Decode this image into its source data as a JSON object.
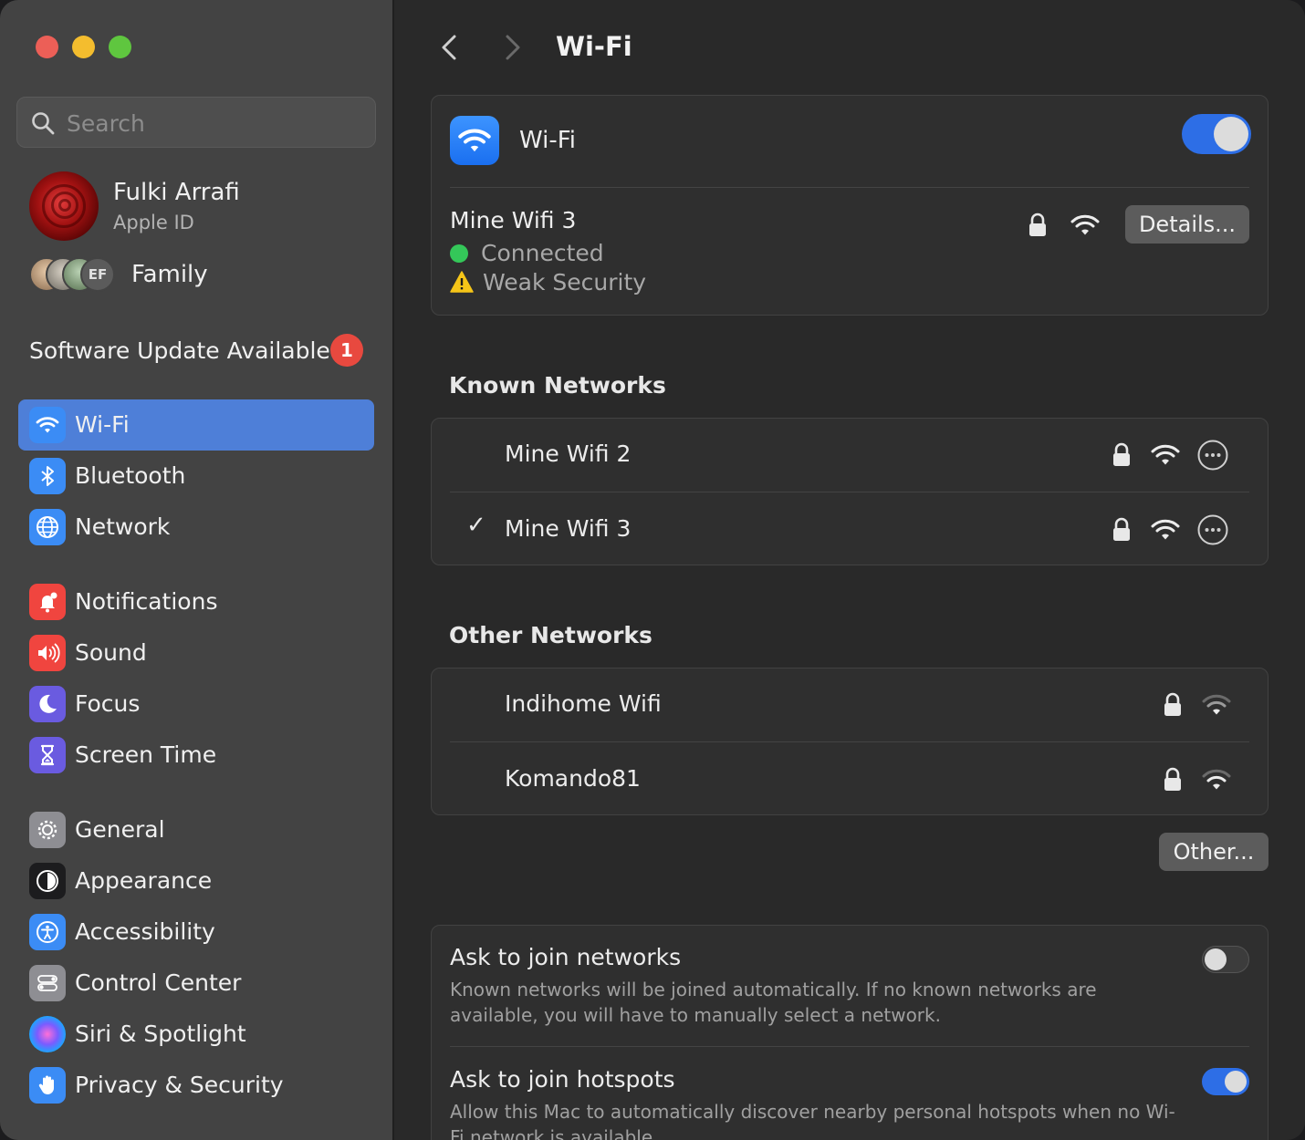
{
  "sidebar": {
    "search_placeholder": "Search",
    "profile": {
      "name": "Fulki Arrafi",
      "subtitle": "Apple ID"
    },
    "family": {
      "avatar_initials": "EF",
      "label": "Family"
    },
    "software_update": {
      "label": "Software Update Available",
      "badge": "1"
    },
    "items": [
      {
        "label": "Wi-Fi",
        "icon": "wifi-icon",
        "color": "#3b8cf5",
        "active": true
      },
      {
        "label": "Bluetooth",
        "icon": "bluetooth-icon",
        "color": "#3b8cf5"
      },
      {
        "label": "Network",
        "icon": "globe-icon",
        "color": "#3b8cf5"
      },
      {
        "label": "Notifications",
        "icon": "bell-icon",
        "color": "#f0453f"
      },
      {
        "label": "Sound",
        "icon": "speaker-icon",
        "color": "#f0453f"
      },
      {
        "label": "Focus",
        "icon": "moon-icon",
        "color": "#6a5be0"
      },
      {
        "label": "Screen Time",
        "icon": "hourglass-icon",
        "color": "#6a5be0"
      },
      {
        "label": "General",
        "icon": "gear-icon",
        "color": "#8e8e93"
      },
      {
        "label": "Appearance",
        "icon": "appearance-icon",
        "color": "#1c1c1e"
      },
      {
        "label": "Accessibility",
        "icon": "accessibility-icon",
        "color": "#3b8cf5"
      },
      {
        "label": "Control Center",
        "icon": "control-center-icon",
        "color": "#8e8e93"
      },
      {
        "label": "Siri & Spotlight",
        "icon": "siri-icon",
        "color": "#2b2b55"
      },
      {
        "label": "Privacy & Security",
        "icon": "hand-icon",
        "color": "#3b8cf5"
      }
    ]
  },
  "header": {
    "title": "Wi-Fi"
  },
  "wifi": {
    "label": "Wi-Fi",
    "enabled": true,
    "current": {
      "name": "Mine Wifi 3",
      "status": "Connected",
      "warning": "Weak Security",
      "details_label": "Details..."
    }
  },
  "known_networks": {
    "title": "Known Networks",
    "items": [
      {
        "name": "Mine Wifi 2",
        "checked": false
      },
      {
        "name": "Mine Wifi 3",
        "checked": true,
        "check_mark": "✓"
      }
    ]
  },
  "other_networks": {
    "title": "Other Networks",
    "items": [
      {
        "name": "Indihome Wifi"
      },
      {
        "name": "Komando81"
      }
    ],
    "other_label": "Other..."
  },
  "options": {
    "ask_networks": {
      "title": "Ask to join networks",
      "description": "Known networks will be joined automatically. If no known networks are available, you will have to manually select a network.",
      "enabled": false
    },
    "ask_hotspots": {
      "title": "Ask to join hotspots",
      "description": "Allow this Mac to automatically discover nearby personal hotspots when no Wi-Fi network is available.",
      "enabled": true
    }
  },
  "colors": {
    "accent": "#2d6ee6",
    "sidebar_selection": "#4e7fd8",
    "connected": "#34c759",
    "warning": "#f5c518",
    "badge": "#e8493f"
  }
}
